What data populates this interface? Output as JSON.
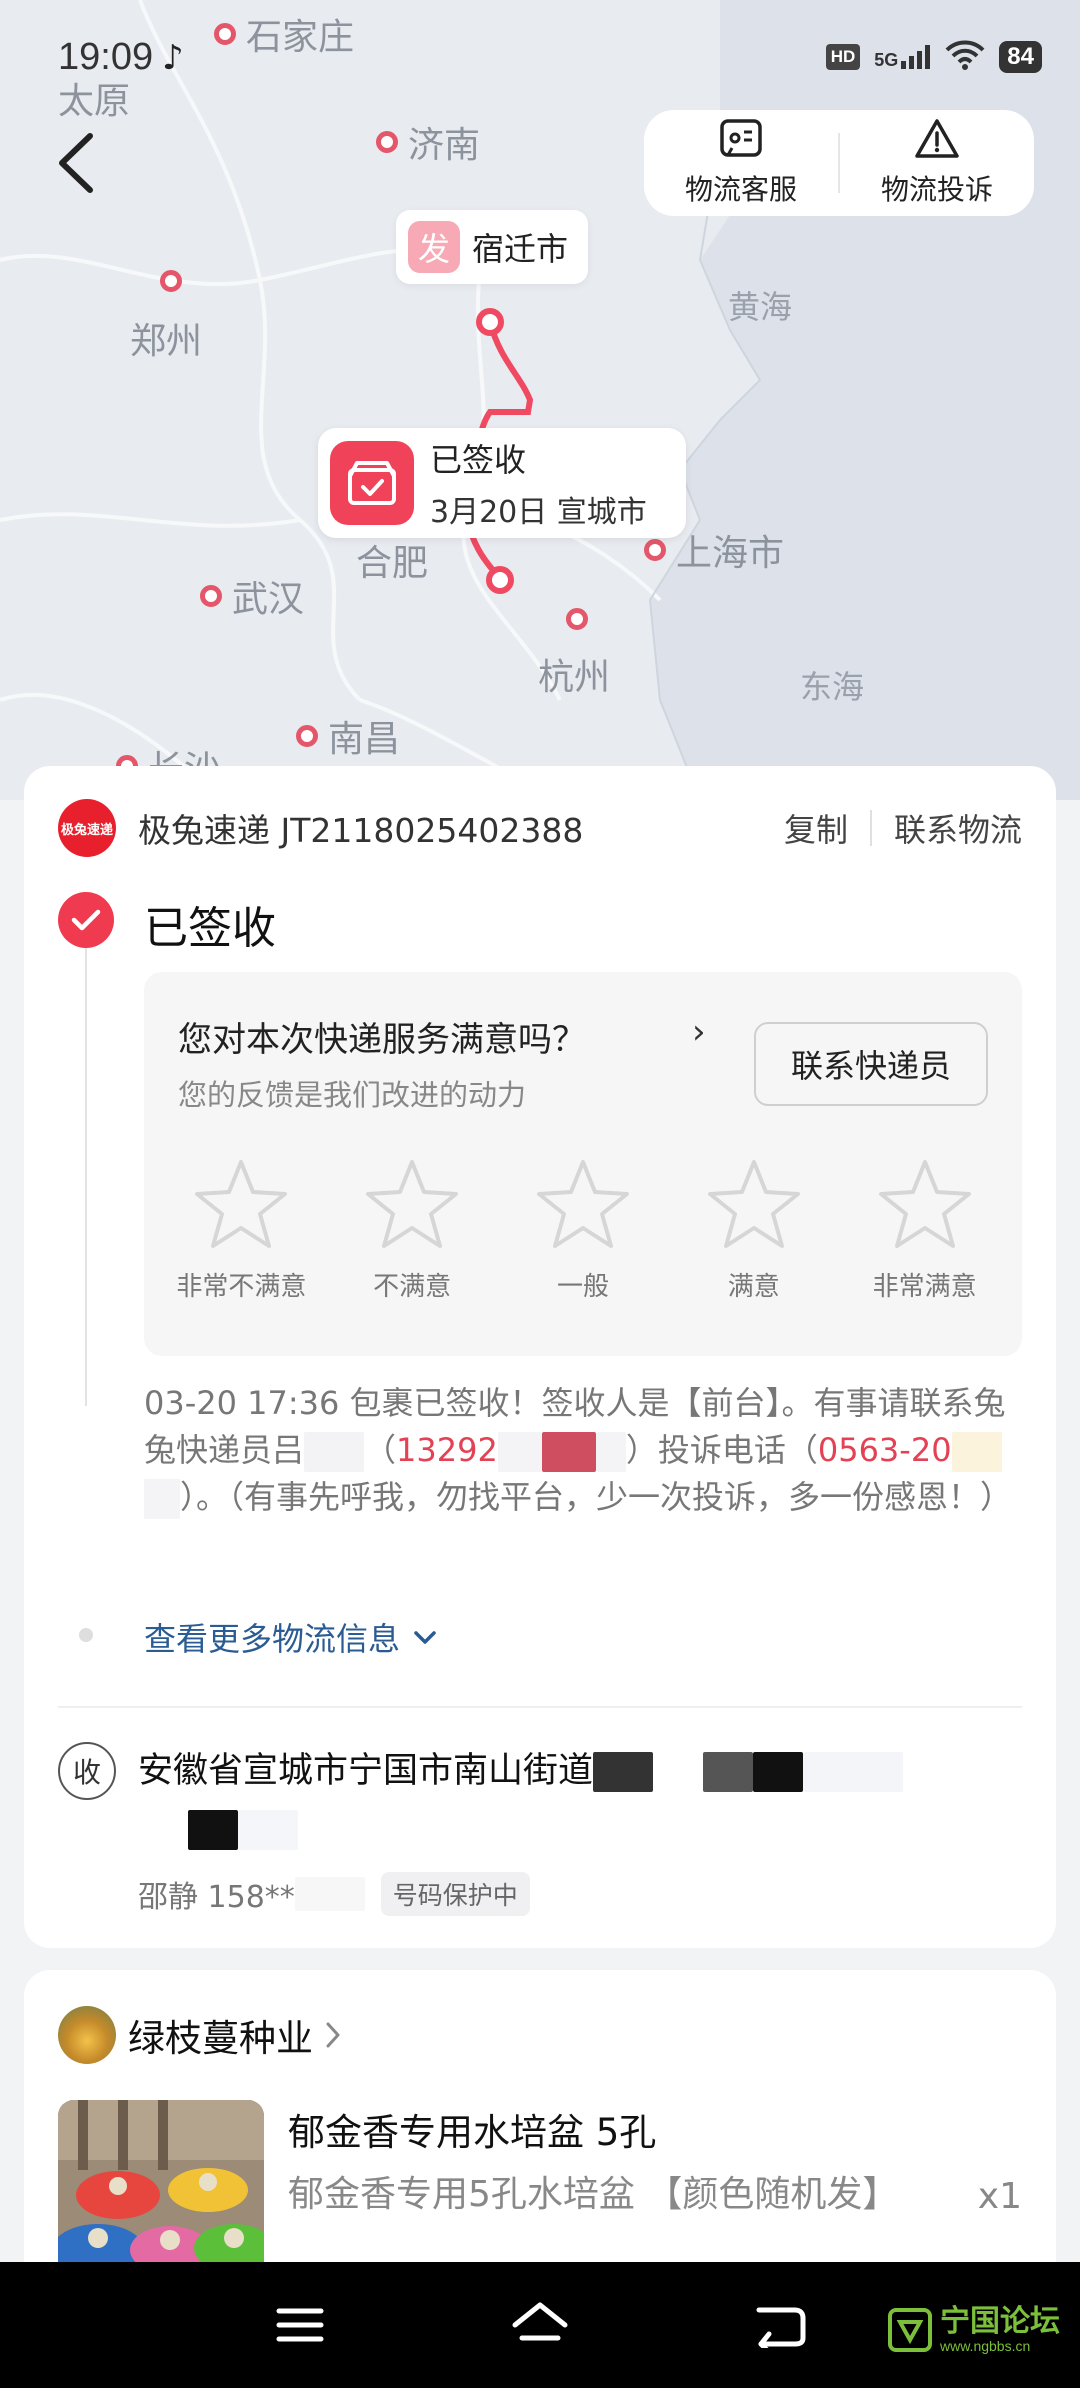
{
  "status_bar": {
    "time": "19:09",
    "tiktok_glyph": "♪",
    "hd": "HD",
    "network": "5G",
    "battery": "84"
  },
  "map": {
    "cities": [
      "石家庄",
      "太原",
      "济南",
      "郑州",
      "武汉",
      "合肥",
      "南昌",
      "长沙",
      "杭州",
      "上海市"
    ],
    "seas": [
      "黄海",
      "东海",
      "海"
    ],
    "origin": {
      "badge": "发",
      "city": "宿迁市"
    },
    "delivered": {
      "title": "已签收",
      "detail": "3月20日 宣城市"
    }
  },
  "top_actions": {
    "service": "物流客服",
    "complaint": "物流投诉"
  },
  "shipment": {
    "carrier_logo_text": "极兔速递",
    "carrier_line": "极兔速递 JT2118025402388",
    "copy": "复制",
    "contact_logistics": "联系物流",
    "status": "已签收"
  },
  "survey": {
    "question": "您对本次快递服务满意吗？",
    "arrow": "›",
    "subtitle": "您的反馈是我们改进的动力",
    "contact_courier": "联系快递员",
    "ratings": [
      "非常不满意",
      "不满意",
      "一般",
      "满意",
      "非常满意"
    ]
  },
  "log": {
    "p1": "03-20 17:36 包裹已签收！签收人是【前台】。有事请联系兔兔快递员吕",
    "p2": "（",
    "phone": "13292",
    "p3": "）投诉电话（",
    "complaint_phone": "0563-20",
    "p4": "）。（有事先呼我，勿找平台，少一次投诉，多一份感恩！）"
  },
  "more_info": "查看更多物流信息",
  "receiver": {
    "icon_text": "收",
    "address": "安徽省宣城市宁国市南山街道",
    "name_phone": "邵静 158**",
    "protect_badge": "号码保护中"
  },
  "shop": {
    "name": "绿枝蔓种业",
    "product_title": "郁金香专用水培盆 5孔",
    "product_spec": "郁金香专用5孔水培盆 【颜色随机发】",
    "qty": "x1"
  },
  "watermark": {
    "title": "宁国论坛",
    "url": "www.ngbbs.cn"
  }
}
